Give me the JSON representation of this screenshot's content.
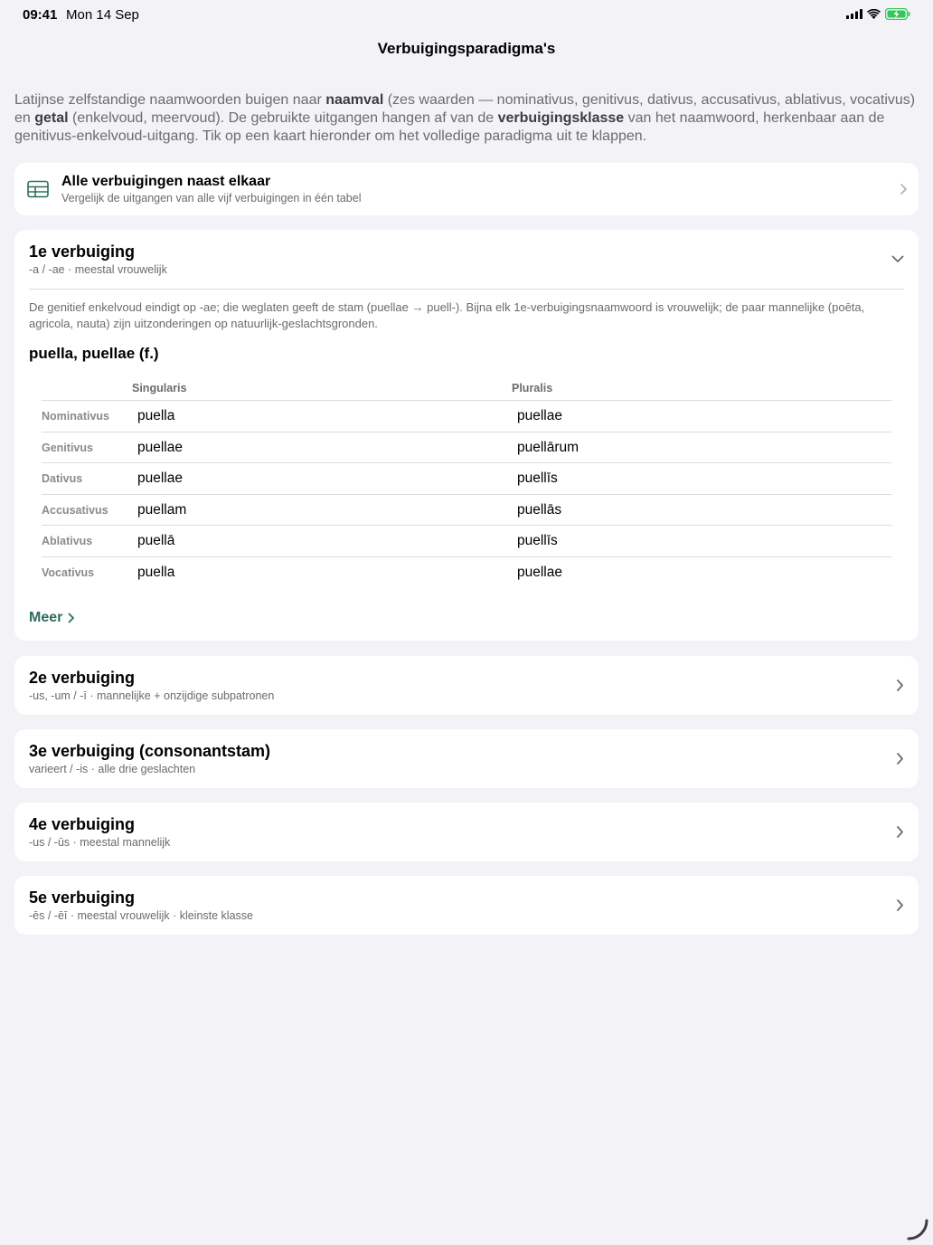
{
  "status_bar": {
    "time": "09:41",
    "date": "Mon 14 Sep"
  },
  "nav": {
    "title": "Verbuigingsparadigma's"
  },
  "intro": {
    "t1": "Latijnse zelfstandige naamwoorden buigen naar ",
    "b1": "naamval",
    "t2": " (zes waarden — nominativus, genitivus, dativus, accusativus, ablativus, vocativus) en ",
    "b2": "getal",
    "t3": " (enkelvoud, meervoud). De gebruikte uitgangen hangen af van de ",
    "b3": "verbuigingsklasse",
    "t4": " van het naamwoord, herkenbaar aan de genitivus-enkelvoud-uitgang. Tik op een kaart hieronder om het volledige paradigma uit te klappen."
  },
  "compare": {
    "title": "Alle verbuigingen naast elkaar",
    "subtitle": "Vergelijk de uitgangen van alle vijf verbuigingen in één tabel",
    "icon": "table-icon"
  },
  "declension1": {
    "title": "1e verbuiging",
    "subtitle": "-a / -ae · meestal vrouwelijk",
    "explanation": "De genitief enkelvoud eindigt op -ae; die weglaten geeft de stam (puellae → puell-). Bijna elk 1e-verbuigingsnaamwoord is vrouwelijk; de paar mannelijke (poēta, agricola, nauta) zijn uitzonderingen op natuurlijk-geslachtsgronden.",
    "lemma": "puella, puellae (f.)",
    "columns": {
      "singular": "Singularis",
      "plural": "Pluralis"
    },
    "rows": [
      {
        "case": "Nominativus",
        "sg": "puella",
        "pl": "puellae"
      },
      {
        "case": "Genitivus",
        "sg": "puellae",
        "pl": "puellārum"
      },
      {
        "case": "Dativus",
        "sg": "puellae",
        "pl": "puellīs"
      },
      {
        "case": "Accusativus",
        "sg": "puellam",
        "pl": "puellās"
      },
      {
        "case": "Ablativus",
        "sg": "puellā",
        "pl": "puellīs"
      },
      {
        "case": "Vocativus",
        "sg": "puella",
        "pl": "puellae"
      }
    ],
    "more_label": "Meer"
  },
  "declensions": [
    {
      "title": "2e verbuiging",
      "subtitle": "-us, -um / -ī · mannelijke + onzijdige subpatronen"
    },
    {
      "title": "3e verbuiging (consonantstam)",
      "subtitle": "varieert / -is · alle drie geslachten"
    },
    {
      "title": "4e verbuiging",
      "subtitle": "-us / -ūs · meestal mannelijk"
    },
    {
      "title": "5e verbuiging",
      "subtitle": "-ēs / -ēī · meestal vrouwelijk · kleinste klasse"
    }
  ],
  "colors": {
    "accent": "#2b6e5d",
    "background": "#f2f2f7",
    "card": "#ffffff",
    "secondary_text": "#6b6b70"
  }
}
